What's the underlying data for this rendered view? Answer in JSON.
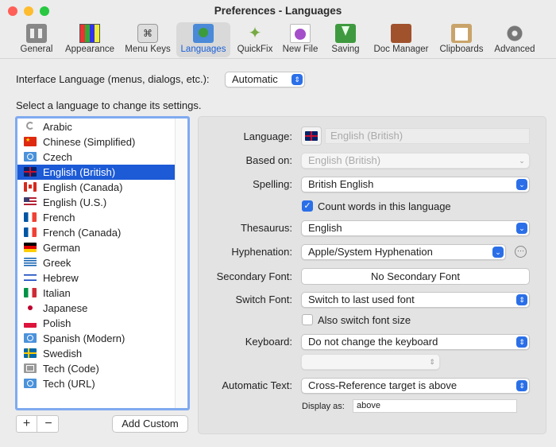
{
  "window": {
    "title": "Preferences - Languages"
  },
  "toolbar": {
    "items": [
      {
        "label": "General",
        "icon": "general-icon"
      },
      {
        "label": "Appearance",
        "icon": "appearance-icon"
      },
      {
        "label": "Menu Keys",
        "icon": "menu-keys-icon"
      },
      {
        "label": "Languages",
        "icon": "languages-icon",
        "selected": true
      },
      {
        "label": "QuickFix",
        "icon": "quickfix-icon"
      },
      {
        "label": "New File",
        "icon": "new-file-icon"
      },
      {
        "label": "Saving",
        "icon": "saving-icon"
      },
      {
        "label": "Doc Manager",
        "icon": "doc-manager-icon"
      },
      {
        "label": "Clipboards",
        "icon": "clipboards-icon"
      },
      {
        "label": "Advanced",
        "icon": "advanced-icon"
      }
    ],
    "menu_keys_glyph": "⌘"
  },
  "interface_language": {
    "label": "Interface Language (menus, dialogs, etc.):",
    "value": "Automatic"
  },
  "language_list": {
    "instruction": "Select a language to change its settings.",
    "items": [
      {
        "name": "Arabic",
        "flag": "crescent"
      },
      {
        "name": "Chinese (Simplified)",
        "flag": "china"
      },
      {
        "name": "Czech",
        "flag": "un"
      },
      {
        "name": "English (British)",
        "flag": "uk",
        "selected": true
      },
      {
        "name": "English (Canada)",
        "flag": "canada"
      },
      {
        "name": "English (U.S.)",
        "flag": "usa"
      },
      {
        "name": "French",
        "flag": "france"
      },
      {
        "name": "French (Canada)",
        "flag": "france"
      },
      {
        "name": "German",
        "flag": "germany"
      },
      {
        "name": "Greek",
        "flag": "greece"
      },
      {
        "name": "Hebrew",
        "flag": "israel"
      },
      {
        "name": "Italian",
        "flag": "italy"
      },
      {
        "name": "Japanese",
        "flag": "japan"
      },
      {
        "name": "Polish",
        "flag": "poland"
      },
      {
        "name": "Spanish (Modern)",
        "flag": "un"
      },
      {
        "name": "Swedish",
        "flag": "sweden"
      },
      {
        "name": "Tech (Code)",
        "flag": "tech"
      },
      {
        "name": "Tech (URL)",
        "flag": "un"
      }
    ],
    "add_label": "+",
    "remove_label": "−",
    "add_custom_label": "Add Custom"
  },
  "settings": {
    "language_label": "Language:",
    "language_value": "English (British)",
    "based_on_label": "Based on:",
    "based_on_value": "English (British)",
    "spelling_label": "Spelling:",
    "spelling_value": "British English",
    "count_words_label": "Count words in this language",
    "count_words_checked": true,
    "thesaurus_label": "Thesaurus:",
    "thesaurus_value": "English",
    "hyphenation_label": "Hyphenation:",
    "hyphenation_value": "Apple/System Hyphenation",
    "secondary_font_label": "Secondary Font:",
    "secondary_font_value": "No Secondary Font",
    "switch_font_label": "Switch Font:",
    "switch_font_value": "Switch to last used font",
    "also_switch_size_label": "Also switch font size",
    "also_switch_size_checked": false,
    "keyboard_label": "Keyboard:",
    "keyboard_value": "Do not change the keyboard",
    "keyboard_sub_value": "",
    "automatic_text_label": "Automatic Text:",
    "automatic_text_value": "Cross-Reference target is above",
    "display_as_label": "Display as:",
    "display_as_value": "above",
    "more_glyph": "···"
  },
  "colors": {
    "accent": "#1c5ad6",
    "list_focus_ring": "#7faaf0"
  }
}
